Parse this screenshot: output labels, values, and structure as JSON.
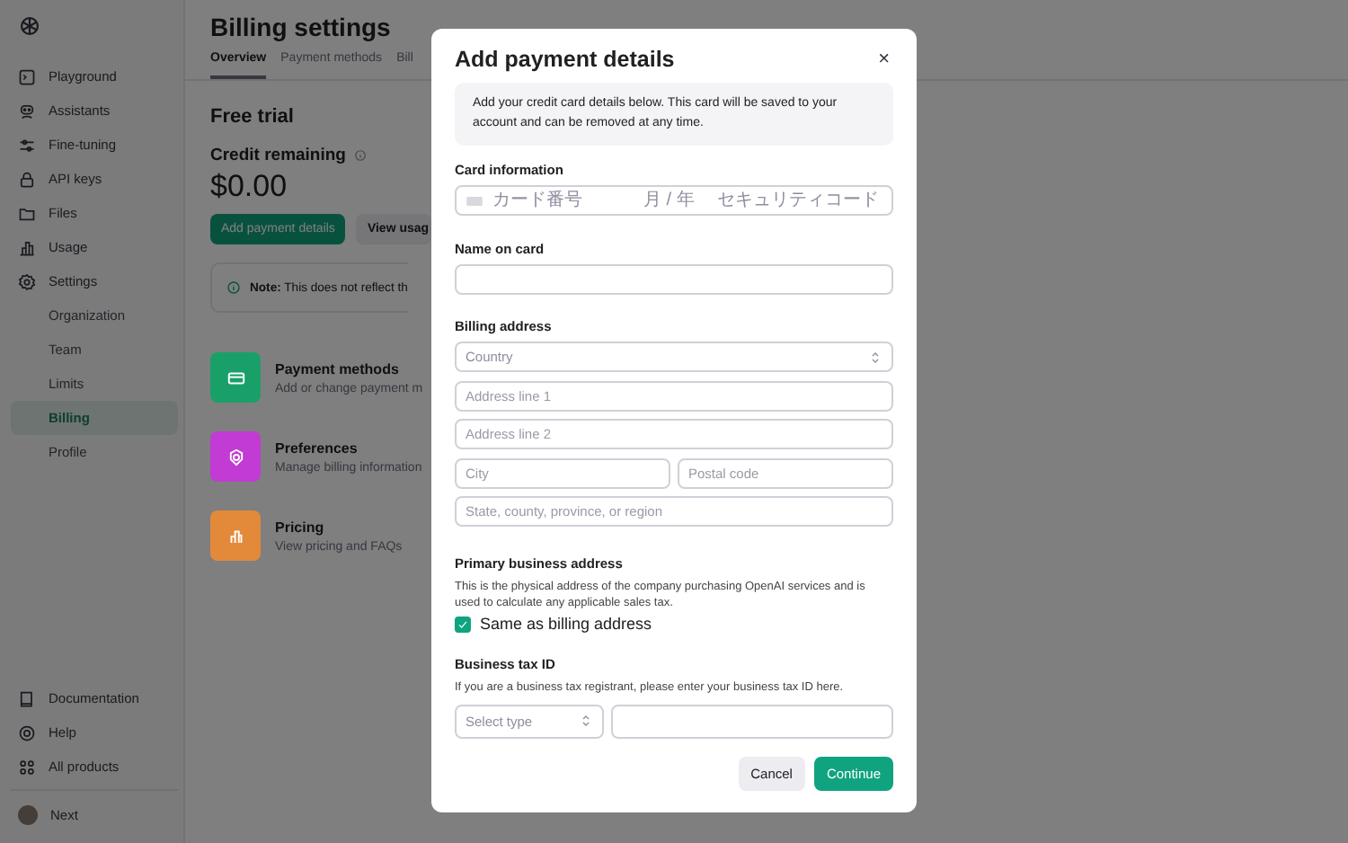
{
  "sidebar": {
    "items": [
      {
        "label": "Playground",
        "selected": false
      },
      {
        "label": "Assistants",
        "selected": false
      },
      {
        "label": "Fine-tuning",
        "selected": false
      },
      {
        "label": "API keys",
        "selected": false
      },
      {
        "label": "Files",
        "selected": false
      },
      {
        "label": "Usage",
        "selected": false
      },
      {
        "label": "Settings",
        "selected": false,
        "children": [
          {
            "label": "Organization",
            "selected": false
          },
          {
            "label": "Team",
            "selected": false
          },
          {
            "label": "Limits",
            "selected": false
          },
          {
            "label": "Billing",
            "selected": true
          },
          {
            "label": "Profile",
            "selected": false
          }
        ]
      }
    ],
    "footer_items": [
      {
        "label": "Documentation"
      },
      {
        "label": "Help"
      },
      {
        "label": "All products"
      }
    ],
    "user": {
      "name": "Next"
    }
  },
  "main": {
    "title": "Billing settings",
    "tabs": [
      {
        "label": "Overview",
        "selected": true
      },
      {
        "label": "Payment methods",
        "selected": false
      },
      {
        "label": "Bill",
        "selected": false
      }
    ],
    "section_title": "Free trial",
    "credit_label": "Credit remaining",
    "amount": "$0.00",
    "buttons": [
      {
        "label": "Add payment details",
        "kind": "primary"
      },
      {
        "label": "View usag",
        "kind": "secondary"
      }
    ],
    "note": "**Note:** This does not reflect th",
    "cards": [
      {
        "title": "Payment methods",
        "description": "Add or change payment m",
        "color": "#19a068"
      },
      {
        "title": "Preferences",
        "description": "Manage billing information",
        "color": "#c23bd4"
      },
      {
        "title": "Pricing",
        "description": "View pricing and FAQs",
        "color": "#e3893a"
      }
    ]
  },
  "modal": {
    "title": "Add payment details",
    "close": "×",
    "info": "Add your credit card details below. This card will be saved to your account and can be removed at any time.",
    "card_information": {
      "label": "Card information",
      "number_placeholder": "カード番号",
      "expiry_placeholder": "月 / 年",
      "cvc_placeholder": "セキュリティコード"
    },
    "name_on_card": {
      "label": "Name on card"
    },
    "billing_address": {
      "label": "Billing address",
      "country_placeholder": "Country",
      "line1_placeholder": "Address line 1",
      "line2_placeholder": "Address line 2",
      "city_placeholder": "City",
      "postal_placeholder": "Postal code",
      "region_placeholder": "State, county, province, or region"
    },
    "primary_business_address": {
      "label": "Primary business address",
      "description": "This is the physical address of the company purchasing OpenAI services and is used to calculate any applicable sales tax.",
      "checkbox_label": "Same as billing address",
      "checked": true
    },
    "business_tax_id": {
      "label": "Business tax ID",
      "description": "If you are a business tax registrant, please enter your business tax ID here.",
      "type_placeholder": "Select type"
    },
    "buttons": [
      {
        "label": "Cancel",
        "kind": "secondary"
      },
      {
        "label": "Continue",
        "kind": "primary"
      }
    ]
  }
}
